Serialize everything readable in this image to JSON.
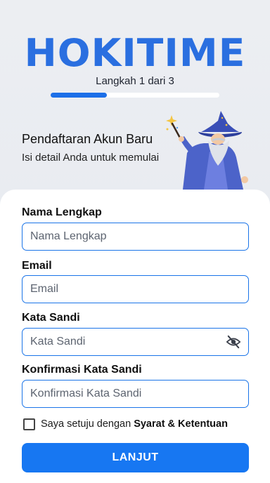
{
  "app": {
    "logo_text": "HOKITIME"
  },
  "progress": {
    "label": "Langkah 1 dari 3",
    "current_step": 1,
    "total_steps": 3,
    "fraction": 0.333
  },
  "intro": {
    "title": "Pendaftaran Akun Baru",
    "subtitle": "Isi detail Anda untuk memulai"
  },
  "form": {
    "full_name": {
      "label": "Nama Lengkap",
      "placeholder": "Nama Lengkap",
      "value": ""
    },
    "email": {
      "label": "Email",
      "placeholder": "Email",
      "value": ""
    },
    "password": {
      "label": "Kata Sandi",
      "placeholder": "Kata Sandi",
      "value": "",
      "toggle_icon": "eye-off-icon"
    },
    "confirm_password": {
      "label": "Konfirmasi Kata Sandi",
      "placeholder": "Konfirmasi Kata Sandi",
      "value": ""
    },
    "terms": {
      "prefix": "Saya setuju dengan",
      "link": "Syarat & Ketentuan",
      "checked": false
    },
    "submit_label": "LANJUT"
  },
  "colors": {
    "accent": "#1777f2",
    "logo": "#2a6fe0",
    "field_border": "#1a74e8"
  }
}
